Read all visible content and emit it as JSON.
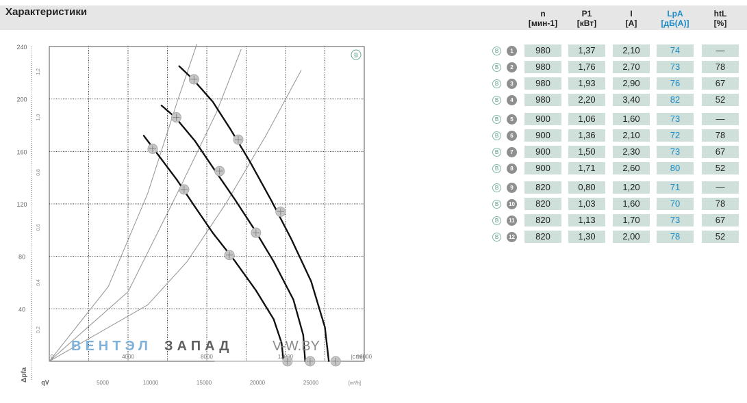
{
  "header": {
    "title": "Характеристики"
  },
  "table": {
    "columns": [
      {
        "key": "n",
        "label": "n",
        "unit": "[мин-1]",
        "accent": false
      },
      {
        "key": "p1",
        "label": "P1",
        "unit": "[кВт]",
        "accent": false
      },
      {
        "key": "i",
        "label": "I",
        "unit": "[А]",
        "accent": false
      },
      {
        "key": "lpa",
        "label": "LpA",
        "unit": "[дБ(А)]",
        "accent": true
      },
      {
        "key": "htl",
        "label": "htL",
        "unit": "[%]",
        "accent": false
      }
    ],
    "badge_label": "B",
    "rows": [
      {
        "num": "1",
        "n": "980",
        "p1": "1,37",
        "i": "2,10",
        "lpa": "74",
        "htl": "—"
      },
      {
        "num": "2",
        "n": "980",
        "p1": "1,76",
        "i": "2,70",
        "lpa": "73",
        "htl": "78"
      },
      {
        "num": "3",
        "n": "980",
        "p1": "1,93",
        "i": "2,90",
        "lpa": "76",
        "htl": "67"
      },
      {
        "num": "4",
        "n": "980",
        "p1": "2,20",
        "i": "3,40",
        "lpa": "82",
        "htl": "52"
      },
      {
        "num": "5",
        "n": "900",
        "p1": "1,06",
        "i": "1,60",
        "lpa": "73",
        "htl": "—"
      },
      {
        "num": "6",
        "n": "900",
        "p1": "1,36",
        "i": "2,10",
        "lpa": "72",
        "htl": "78"
      },
      {
        "num": "7",
        "n": "900",
        "p1": "1,50",
        "i": "2,30",
        "lpa": "73",
        "htl": "67"
      },
      {
        "num": "8",
        "n": "900",
        "p1": "1,71",
        "i": "2,60",
        "lpa": "80",
        "htl": "52"
      },
      {
        "num": "9",
        "n": "820",
        "p1": "0,80",
        "i": "1,20",
        "lpa": "71",
        "htl": "—"
      },
      {
        "num": "10",
        "n": "820",
        "p1": "1,03",
        "i": "1,60",
        "lpa": "70",
        "htl": "78"
      },
      {
        "num": "11",
        "n": "820",
        "p1": "1,13",
        "i": "1,70",
        "lpa": "73",
        "htl": "67"
      },
      {
        "num": "12",
        "n": "820",
        "p1": "1,30",
        "i": "2,00",
        "lpa": "78",
        "htl": "52"
      }
    ]
  },
  "chart_data": {
    "type": "line",
    "badge_label": "B",
    "ylabel": "Δpfa",
    "xlabel": "qV",
    "y_ticks": [
      "240",
      "200",
      "160",
      "120",
      "80",
      "40"
    ],
    "y2_ticks": [
      "1,2",
      "1,0",
      "0,8",
      "0,6",
      "0,4",
      "0,2"
    ],
    "x_ticks": [
      "0",
      "4000",
      "8000",
      "12000",
      "16000"
    ],
    "x_unit": "[CFM]",
    "x2_ticks": [
      "5000",
      "10000",
      "15000",
      "20000",
      "25000"
    ],
    "x2_unit": "[m³/h]",
    "xlim": [
      0,
      16000
    ],
    "ylim": [
      0,
      240
    ],
    "series": [
      {
        "values": [
          [
            4800,
            172
          ],
          [
            5200,
            164
          ],
          [
            6500,
            138
          ],
          [
            7300,
            120
          ],
          [
            8300,
            98
          ],
          [
            9400,
            77
          ],
          [
            10500,
            54
          ],
          [
            11400,
            32
          ],
          [
            11800,
            14
          ],
          [
            11900,
            0
          ]
        ],
        "markers": [
          [
            5250,
            162
          ],
          [
            6850,
            131
          ],
          [
            9150,
            81
          ],
          [
            12100,
            0
          ]
        ]
      },
      {
        "values": [
          [
            5700,
            195
          ],
          [
            6400,
            186
          ],
          [
            7400,
            168
          ],
          [
            8300,
            148
          ],
          [
            9400,
            124
          ],
          [
            10400,
            101
          ],
          [
            11400,
            76
          ],
          [
            12400,
            47
          ],
          [
            12900,
            20
          ],
          [
            13000,
            0
          ]
        ],
        "markers": [
          [
            6450,
            186
          ],
          [
            8650,
            145
          ],
          [
            10500,
            98
          ],
          [
            13250,
            0
          ]
        ]
      },
      {
        "values": [
          [
            6600,
            225
          ],
          [
            7300,
            215
          ],
          [
            8300,
            198
          ],
          [
            9200,
            177
          ],
          [
            10200,
            152
          ],
          [
            11300,
            122
          ],
          [
            12300,
            93
          ],
          [
            13300,
            61
          ],
          [
            14000,
            26
          ],
          [
            14200,
            0
          ]
        ],
        "markers": [
          [
            7350,
            215
          ],
          [
            9600,
            169
          ],
          [
            11750,
            114
          ],
          [
            14550,
            0
          ]
        ]
      }
    ],
    "system_curves": [
      {
        "values": [
          [
            0,
            0
          ],
          [
            3000,
            57
          ],
          [
            5000,
            128
          ],
          [
            6500,
            198
          ],
          [
            7500,
            242
          ]
        ]
      },
      {
        "values": [
          [
            0,
            0
          ],
          [
            4000,
            53
          ],
          [
            6500,
            128
          ],
          [
            8500,
            190
          ],
          [
            9750,
            238
          ]
        ]
      },
      {
        "values": [
          [
            0,
            0
          ],
          [
            5000,
            43
          ],
          [
            7000,
            76
          ],
          [
            9000,
            121
          ],
          [
            11000,
            172
          ],
          [
            12800,
            222
          ]
        ]
      },
      {
        "values": [
          [
            8400,
            0
          ],
          [
            9700,
            0
          ],
          [
            10900,
            0
          ],
          [
            12100,
            0
          ],
          [
            13250,
            0
          ],
          [
            14550,
            0
          ]
        ]
      }
    ]
  },
  "watermark": {
    "brand_left": "ВЕНТЭЛ",
    "brand_right": "ЗАПАД",
    "domain": "V-W.BY"
  }
}
